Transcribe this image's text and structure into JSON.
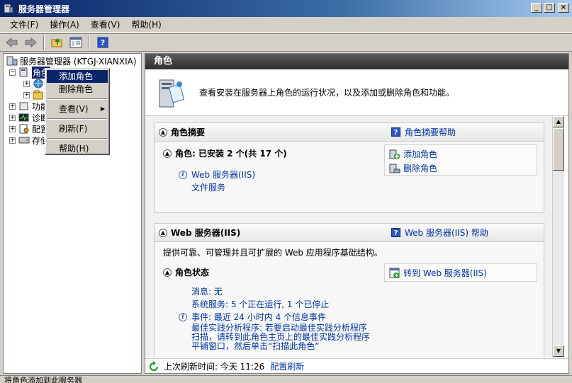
{
  "window": {
    "title": "服务器管理器"
  },
  "window_buttons": {
    "minimize": "_",
    "maximize": "□",
    "close": "×"
  },
  "menubar": [
    "文件(F)",
    "操作(A)",
    "查看(V)",
    "帮助(H)"
  ],
  "tree": {
    "root": "服务器管理器 (KTGJ-XIANXIA)",
    "roles": "角色",
    "features": "功能",
    "diagnostics": "诊断",
    "config": "配置",
    "storage": "存储"
  },
  "context_menu": {
    "add_role": "添加角色",
    "remove_role": "删除角色",
    "view": "查看(V)",
    "refresh": "刷新(F)",
    "help": "帮助(H)"
  },
  "right": {
    "header": "角色",
    "intro": "查看安装在服务器上角色的运行状况，以及添加或删除角色和功能。",
    "summary": {
      "title": "角色摘要",
      "help": "角色摘要帮助",
      "roles_line": "角色: 已安装 2 个(共 17 个)",
      "role1": "Web 服务器(IIS)",
      "role2": "文件服务",
      "add_role": "添加角色",
      "remove_role": "删除角色"
    },
    "web": {
      "title": "Web 服务器(IIS)",
      "help": "Web 服务器(IIS) 帮助",
      "desc": "提供可靠、可管理并且可扩展的 Web 应用程序基础结构。",
      "status_title": "角色状态",
      "goto": "转到 Web 服务器(IIS)",
      "messages": "消息: 无",
      "services": "系统服务: 5 个正在运行, 1 个已停止",
      "events": "事件: 最近 24 小时内 4 个信息事件",
      "bpa_1": "最佳实践分析程序: 若要启动最佳实践分析程序",
      "bpa_2": "扫描，请转到此角色主页上的最佳实践分析程序",
      "bpa_3": "平铺窗口，然后单击“扫描此角色”"
    },
    "refresh": {
      "label": "上次刷新时间: 今天 11:26",
      "link": "配置刷新"
    }
  },
  "statusbar": "将角色添加到此服务器"
}
